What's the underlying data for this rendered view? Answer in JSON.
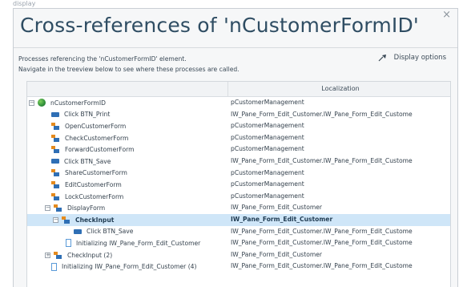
{
  "top_clip_text": "display",
  "dialog": {
    "title": "Cross-references of 'nCustomerFormID'",
    "close_glyph": "×",
    "display_options_label": "Display options",
    "description_line1": "Processes referencing the 'nCustomerFormID' element.",
    "description_line2": "Navigate in the treeview below to see where these processes are called."
  },
  "tree": {
    "column_header": "Localization",
    "rows": [
      {
        "name": "nCustomerFormID",
        "loc": "pCustomerManagement",
        "icon": "globe-icon",
        "expander": "−"
      },
      {
        "name": "Click BTN_Print",
        "loc": "IW_Pane_Form_Edit_Customer.IW_Pane_Form_Edit_Custome",
        "icon": "monitor-icon"
      },
      {
        "name": "OpenCustomerForm",
        "loc": "pCustomerManagement",
        "icon": "flow-icon"
      },
      {
        "name": "CheckCustomerForm",
        "loc": "pCustomerManagement",
        "icon": "flow-icon"
      },
      {
        "name": "ForwardCustomerForm",
        "loc": "pCustomerManagement",
        "icon": "flow-icon"
      },
      {
        "name": "Click BTN_Save",
        "loc": "IW_Pane_Form_Edit_Customer.IW_Pane_Form_Edit_Custome",
        "icon": "monitor-icon"
      },
      {
        "name": "ShareCustomerForm",
        "loc": "pCustomerManagement",
        "icon": "flow-icon"
      },
      {
        "name": "EditCustomerForm",
        "loc": "pCustomerManagement",
        "icon": "flow-icon"
      },
      {
        "name": "LockCustomerForm",
        "loc": "pCustomerManagement",
        "icon": "flow-icon"
      },
      {
        "name": "DisplayForm",
        "loc": "IW_Pane_Form_Edit_Customer",
        "icon": "flow-icon",
        "expander": "−"
      },
      {
        "name": "CheckInput",
        "loc": "IW_Pane_Form_Edit_Customer",
        "icon": "flow-icon",
        "expander": "−",
        "selected": true
      },
      {
        "name": "Click BTN_Save",
        "loc": "IW_Pane_Form_Edit_Customer.IW_Pane_Form_Edit_Custome",
        "icon": "monitor-icon"
      },
      {
        "name": "Initializing IW_Pane_Form_Edit_Customer",
        "loc": "IW_Pane_Form_Edit_Customer.IW_Pane_Form_Edit_Custome",
        "icon": "doc-icon"
      },
      {
        "name": "CheckInput (2)",
        "loc": "IW_Pane_Form_Edit_Customer",
        "icon": "flow-icon",
        "expander": "+"
      },
      {
        "name": "Initializing IW_Pane_Form_Edit_Customer (4)",
        "loc": "IW_Pane_Form_Edit_Customer.IW_Pane_Form_Edit_Custome",
        "icon": "doc-icon"
      }
    ]
  }
}
